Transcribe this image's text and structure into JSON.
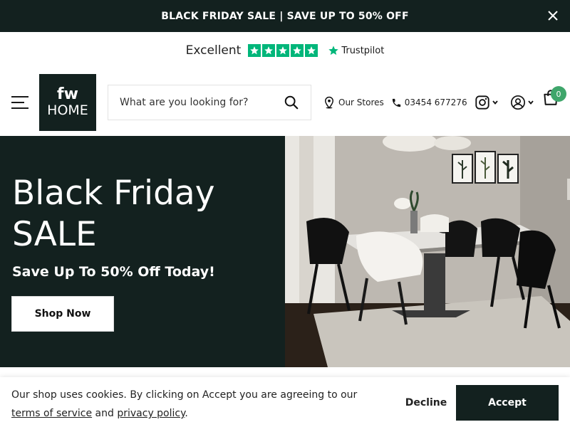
{
  "announcement": {
    "text": "BLACK FRIDAY SALE | SAVE UP TO 50% OFF",
    "close_icon": "close-icon"
  },
  "trustpilot": {
    "rating_label": "Excellent",
    "stars": 5,
    "brand": "Trustpilot",
    "star_color": "#00b67a"
  },
  "header": {
    "logo_line1": "fw",
    "logo_line2": "HOME",
    "search_placeholder": "What are you looking for?",
    "stores_label": "Our Stores",
    "phone": "03454 677276",
    "cart_count": "0"
  },
  "hero": {
    "title_line1": "Black Friday",
    "title_line2": "SALE",
    "subtitle": "Save Up To 50% Off Today!",
    "cta": "Shop Now"
  },
  "cookie": {
    "text_before": "Our shop uses cookies. By clicking on Accept you are agreeing to our ",
    "terms_link": "terms of service",
    "text_middle": " and ",
    "privacy_link": "privacy policy",
    "text_after": ".",
    "decline": "Decline",
    "accept": "Accept"
  },
  "colors": {
    "brand_dark": "#13211f",
    "badge_green": "#3fa66b"
  }
}
